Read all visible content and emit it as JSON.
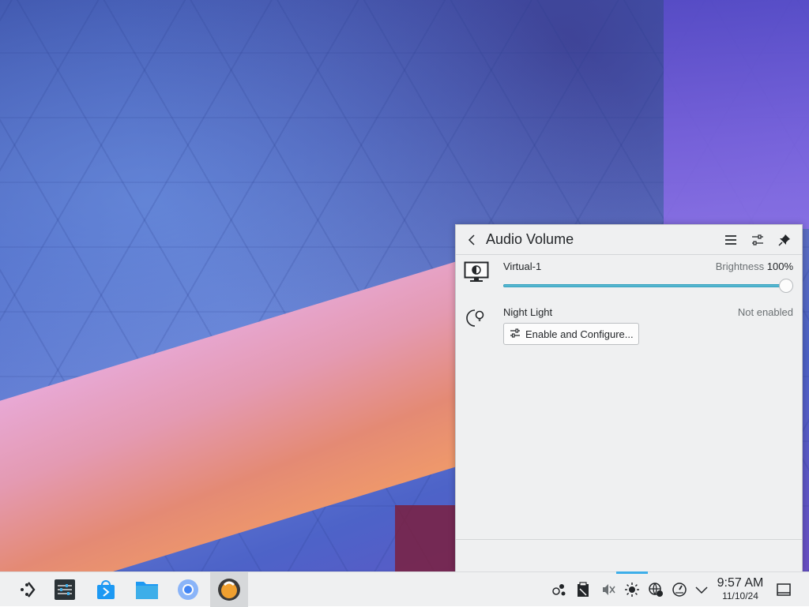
{
  "popup": {
    "title": "Audio Volume",
    "icons": {
      "back": "back-arrow-icon",
      "menu": "hamburger-menu-icon",
      "configure": "configure-sliders-icon",
      "pin": "pin-icon"
    },
    "display": {
      "name": "Virtual-1",
      "brightness_label": "Brightness",
      "brightness_value": "100%",
      "brightness_fraction": 1.0,
      "icon": "monitor-brightness-icon"
    },
    "night_light": {
      "name": "Night Light",
      "status": "Not enabled",
      "button_label": "Enable and Configure...",
      "icon": "night-light-icon"
    }
  },
  "taskbar": {
    "apps": [
      {
        "name": "application-launcher",
        "icon": "kde-launcher-icon"
      },
      {
        "name": "system-settings",
        "icon": "settings-icon"
      },
      {
        "name": "discover",
        "icon": "store-icon"
      },
      {
        "name": "file-manager",
        "icon": "folder-icon"
      },
      {
        "name": "chromium",
        "icon": "chromium-icon"
      },
      {
        "name": "active-app",
        "icon": "orange-app-icon"
      }
    ],
    "tray": [
      "network-share-icon",
      "clipboard-icon",
      "volume-muted-icon",
      "brightness-icon",
      "network-icon",
      "updates-icon",
      "expand-tray-icon"
    ],
    "clock": {
      "time": "9:57 AM",
      "date": "11/10/24"
    }
  },
  "colors": {
    "accent": "#3daee9",
    "slider_fill": "#53b6d0",
    "panel_bg": "#eff0f1"
  }
}
